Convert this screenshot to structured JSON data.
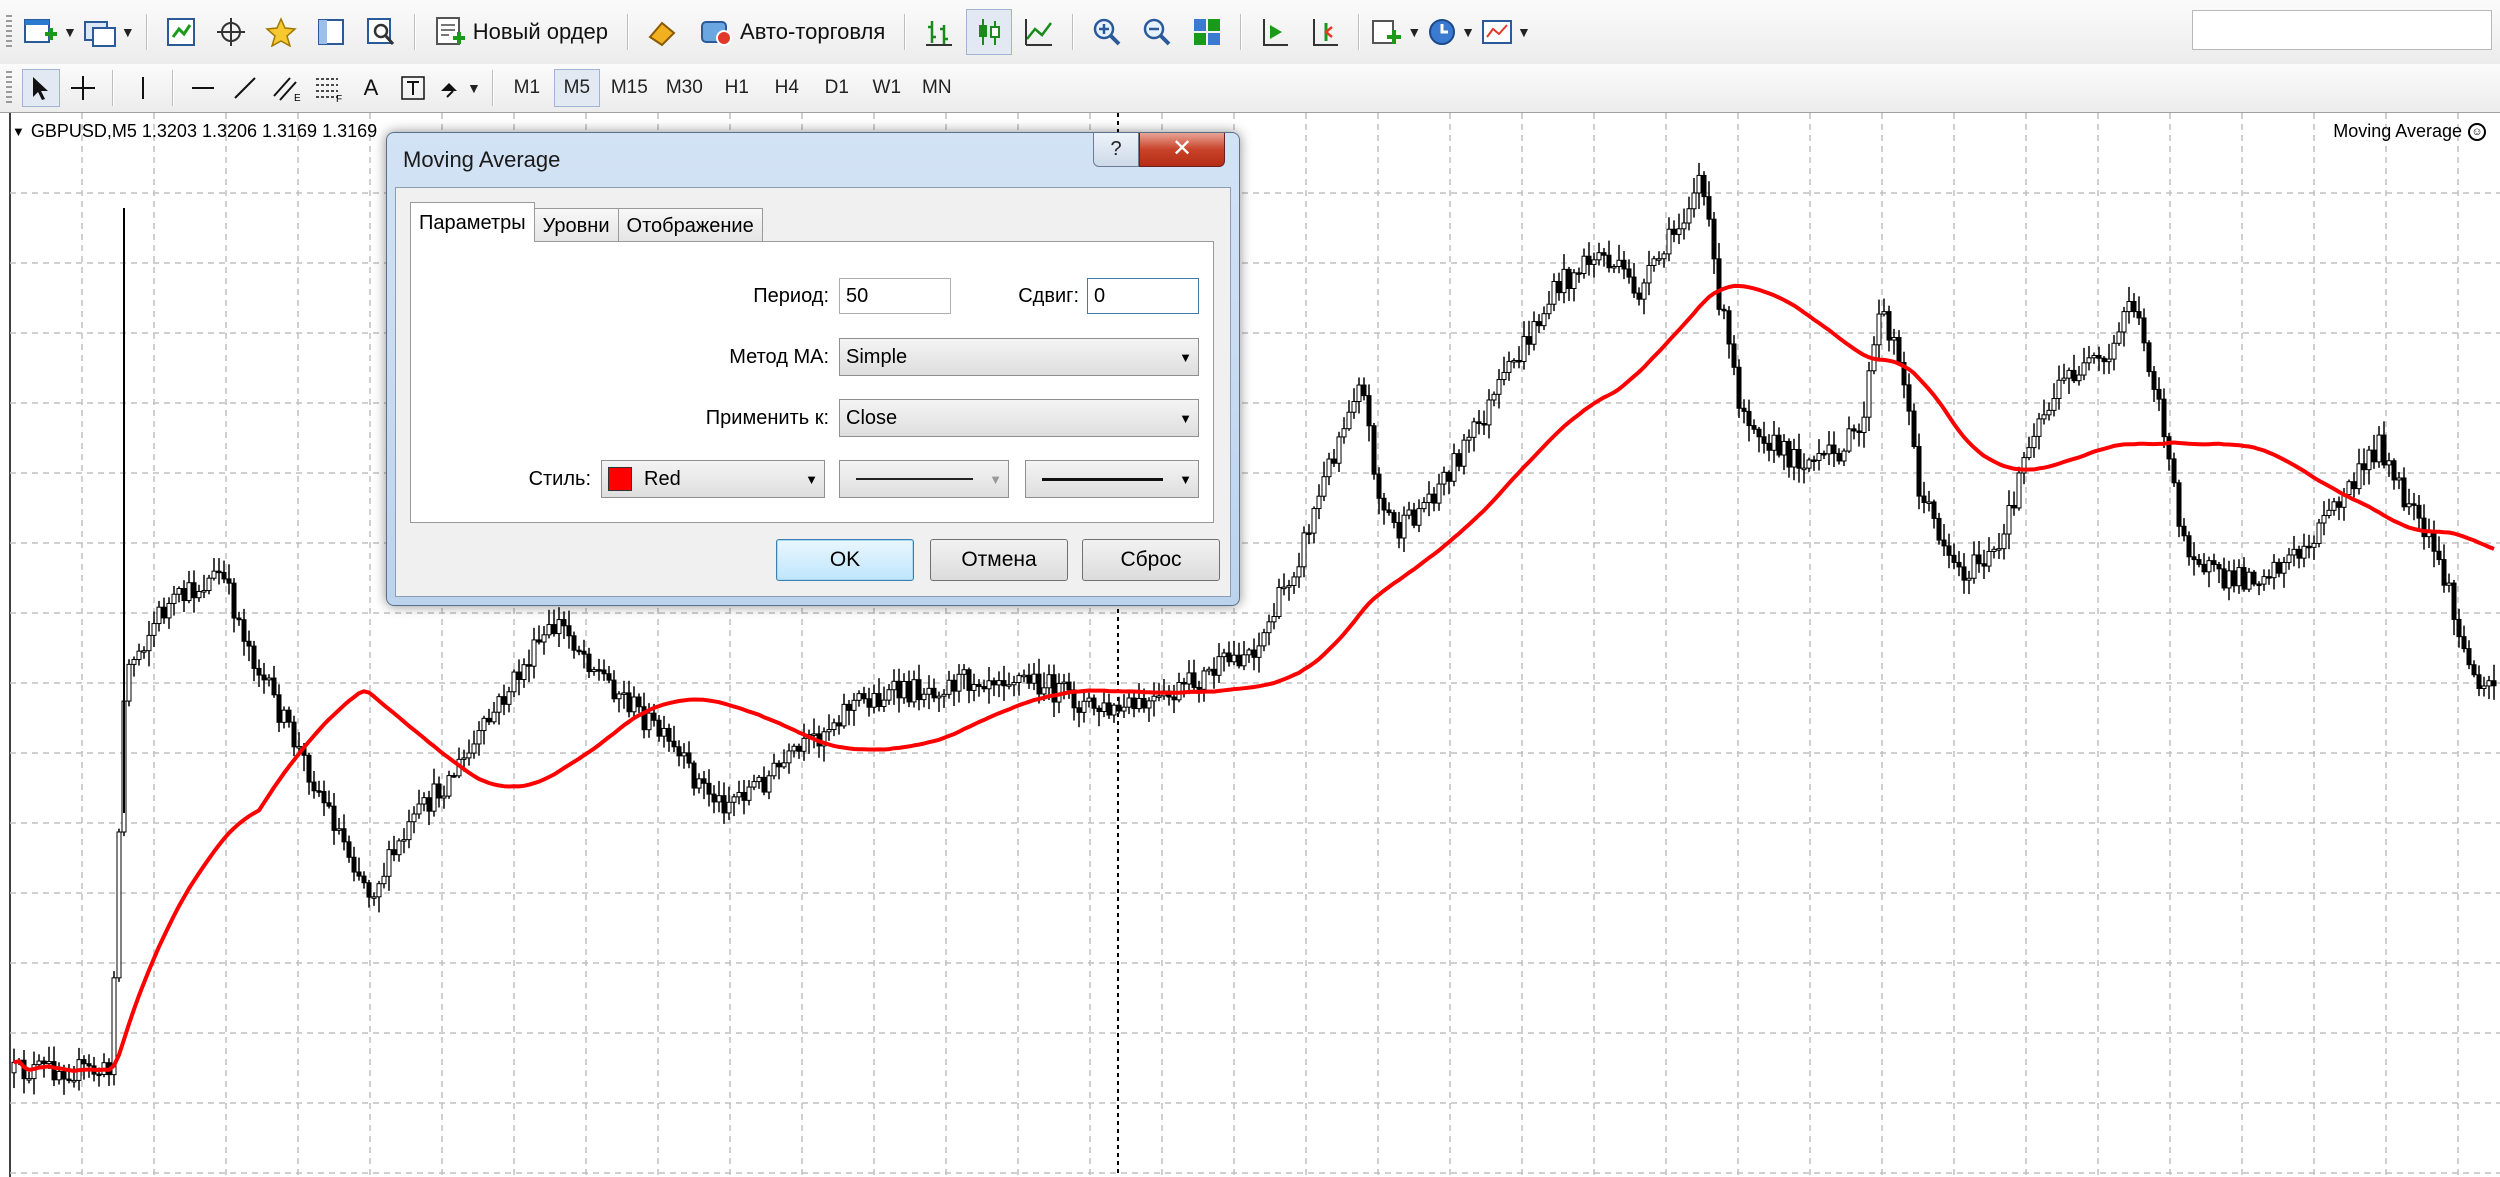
{
  "toolbar": {
    "new_order_label": "Новый ордер",
    "auto_trading_label": "Авто-торговля"
  },
  "timeframes": [
    "M1",
    "M5",
    "M15",
    "M30",
    "H1",
    "H4",
    "D1",
    "W1",
    "MN"
  ],
  "active_timeframe": "M5",
  "chart": {
    "symbol_info": "GBPUSD,M5  1.3203 1.3206 1.3169 1.3169",
    "indicator_label": "Moving Average",
    "candle_color": "#000000",
    "ma_color": "#ff0000",
    "grid_color": "#c0c0c0",
    "background": "#ffffff"
  },
  "dialog": {
    "title": "Moving Average",
    "help_label": "?",
    "close_label": "✕",
    "tabs": [
      {
        "label": "Параметры",
        "active": true
      },
      {
        "label": "Уровни",
        "active": false
      },
      {
        "label": "Отображение",
        "active": false
      }
    ],
    "period_label": "Период:",
    "period_value": "50",
    "shift_label": "Сдвиг:",
    "shift_value": "0",
    "method_label": "Метод МА:",
    "method_value": "Simple",
    "apply_label": "Применить к:",
    "apply_value": "Close",
    "style_label": "Стиль:",
    "color_name": "Red",
    "color_value": "#ff0000",
    "ok_label": "OK",
    "cancel_label": "Отмена",
    "reset_label": "Сброс"
  }
}
